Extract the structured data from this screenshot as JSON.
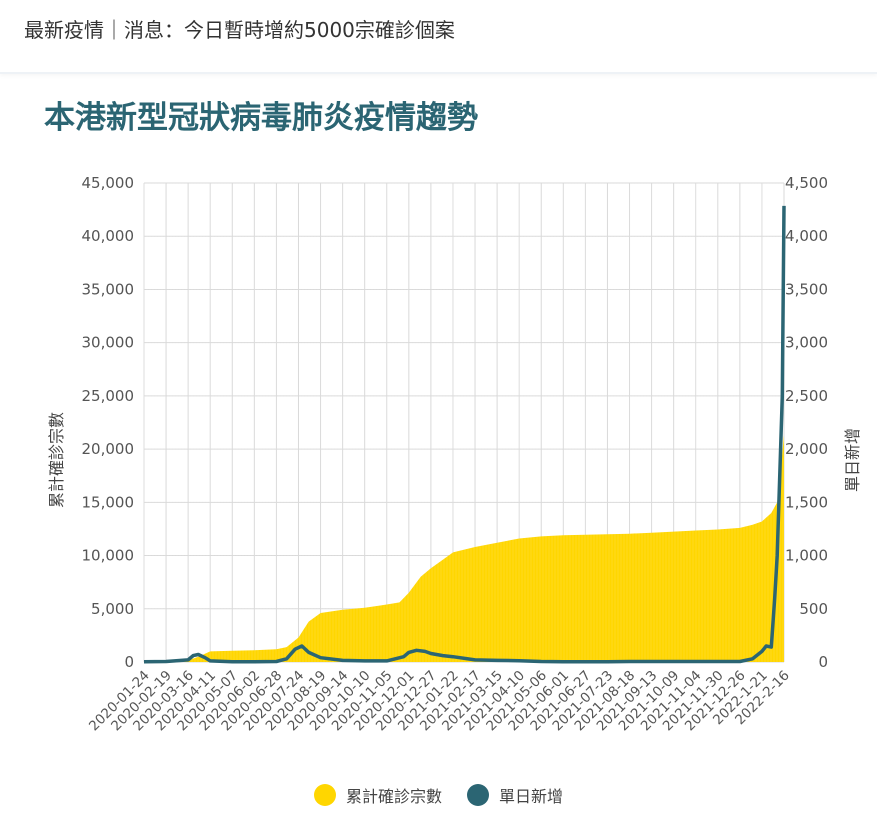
{
  "header": {
    "breadcrumb": "最新疫情｜消息：今日暫時增約5000宗確診個案"
  },
  "page_title": "本港新型冠狀病毒肺炎疫情趨勢",
  "colors": {
    "cumulative": "#ffd600",
    "daily": "#2b6573",
    "title": "#2b6573",
    "grid": "#d9d9d9"
  },
  "legend": {
    "cumulative": "累計確診宗數",
    "daily": "單日新增"
  },
  "chart_data": {
    "type": "area+line",
    "y_left_label": "累計確診宗數",
    "y_right_label": "單日新增",
    "y_left_ticks": [
      "0",
      "5,000",
      "10,000",
      "15,000",
      "20,000",
      "25,000",
      "30,000",
      "35,000",
      "40,000",
      "45,000"
    ],
    "y_right_ticks": [
      "0",
      "500",
      "1,000",
      "1,500",
      "2,000",
      "2,500",
      "3,000",
      "3,500",
      "4,000",
      "4,500"
    ],
    "ylim_left": [
      0,
      45000
    ],
    "ylim_right": [
      0,
      4500
    ],
    "grid": true,
    "legend_position": "bottom",
    "x_tick_labels": [
      "2020-01-24",
      "2020-02-19",
      "2020-03-16",
      "2020-04-11",
      "2020-05-07",
      "2020-06-02",
      "2020-06-28",
      "2020-07-24",
      "2020-08-19",
      "2020-09-14",
      "2020-10-10",
      "2020-11-05",
      "2020-12-01",
      "2020-12-27",
      "2021-01-22",
      "2021-02-17",
      "2021-03-15",
      "2021-04-10",
      "2021-05-06",
      "2021-06-01",
      "2021-06-27",
      "2021-07-23",
      "2021-08-18",
      "2021-09-13",
      "2021-10-09",
      "2021-11-04",
      "2021-11-30",
      "2021-12-26",
      "2022-1-21",
      "2022-2-16"
    ],
    "series": [
      {
        "name": "累計確診宗數",
        "axis": "left",
        "x": [
          "2020-01-24",
          "2020-02-19",
          "2020-03-16",
          "2020-03-28",
          "2020-04-11",
          "2020-05-07",
          "2020-06-02",
          "2020-06-28",
          "2020-07-10",
          "2020-07-24",
          "2020-08-05",
          "2020-08-19",
          "2020-09-14",
          "2020-10-10",
          "2020-11-05",
          "2020-11-20",
          "2020-12-01",
          "2020-12-15",
          "2020-12-27",
          "2021-01-10",
          "2021-01-22",
          "2021-02-17",
          "2021-03-15",
          "2021-04-10",
          "2021-05-06",
          "2021-06-01",
          "2021-06-27",
          "2021-07-23",
          "2021-08-18",
          "2021-09-13",
          "2021-10-09",
          "2021-11-04",
          "2021-11-30",
          "2021-12-26",
          "2022-01-10",
          "2022-01-21",
          "2022-02-01",
          "2022-02-08",
          "2022-02-12",
          "2022-02-16"
        ],
        "values": [
          5,
          70,
          150,
          500,
          1000,
          1050,
          1100,
          1200,
          1400,
          2300,
          3800,
          4600,
          4900,
          5100,
          5400,
          5600,
          6500,
          8000,
          8800,
          9600,
          10300,
          10800,
          11200,
          11600,
          11800,
          11900,
          11950,
          12000,
          12050,
          12150,
          12250,
          12350,
          12450,
          12600,
          12900,
          13200,
          14000,
          15000,
          18000,
          21300
        ]
      },
      {
        "name": "單日新增",
        "axis": "right",
        "x": [
          "2020-01-24",
          "2020-02-19",
          "2020-03-16",
          "2020-03-22",
          "2020-03-28",
          "2020-04-05",
          "2020-04-11",
          "2020-05-07",
          "2020-06-02",
          "2020-06-28",
          "2020-07-10",
          "2020-07-20",
          "2020-07-28",
          "2020-08-05",
          "2020-08-19",
          "2020-09-14",
          "2020-10-10",
          "2020-11-05",
          "2020-11-25",
          "2020-12-01",
          "2020-12-10",
          "2020-12-20",
          "2020-12-27",
          "2021-01-10",
          "2021-01-22",
          "2021-02-17",
          "2021-03-15",
          "2021-04-10",
          "2021-05-06",
          "2021-06-01",
          "2021-06-27",
          "2021-07-23",
          "2021-08-18",
          "2021-09-13",
          "2021-10-09",
          "2021-11-04",
          "2021-11-30",
          "2021-12-26",
          "2022-01-10",
          "2022-01-21",
          "2022-01-26",
          "2022-02-01",
          "2022-02-05",
          "2022-02-08",
          "2022-02-10",
          "2022-02-12",
          "2022-02-14",
          "2022-02-16"
        ],
        "values": [
          2,
          5,
          20,
          60,
          70,
          40,
          10,
          3,
          2,
          5,
          30,
          120,
          150,
          90,
          40,
          15,
          10,
          10,
          50,
          90,
          110,
          100,
          80,
          60,
          50,
          20,
          15,
          12,
          5,
          3,
          2,
          2,
          5,
          5,
          5,
          5,
          5,
          5,
          30,
          100,
          150,
          140,
          600,
          1000,
          1500,
          2000,
          2500,
          4285
        ]
      }
    ]
  }
}
